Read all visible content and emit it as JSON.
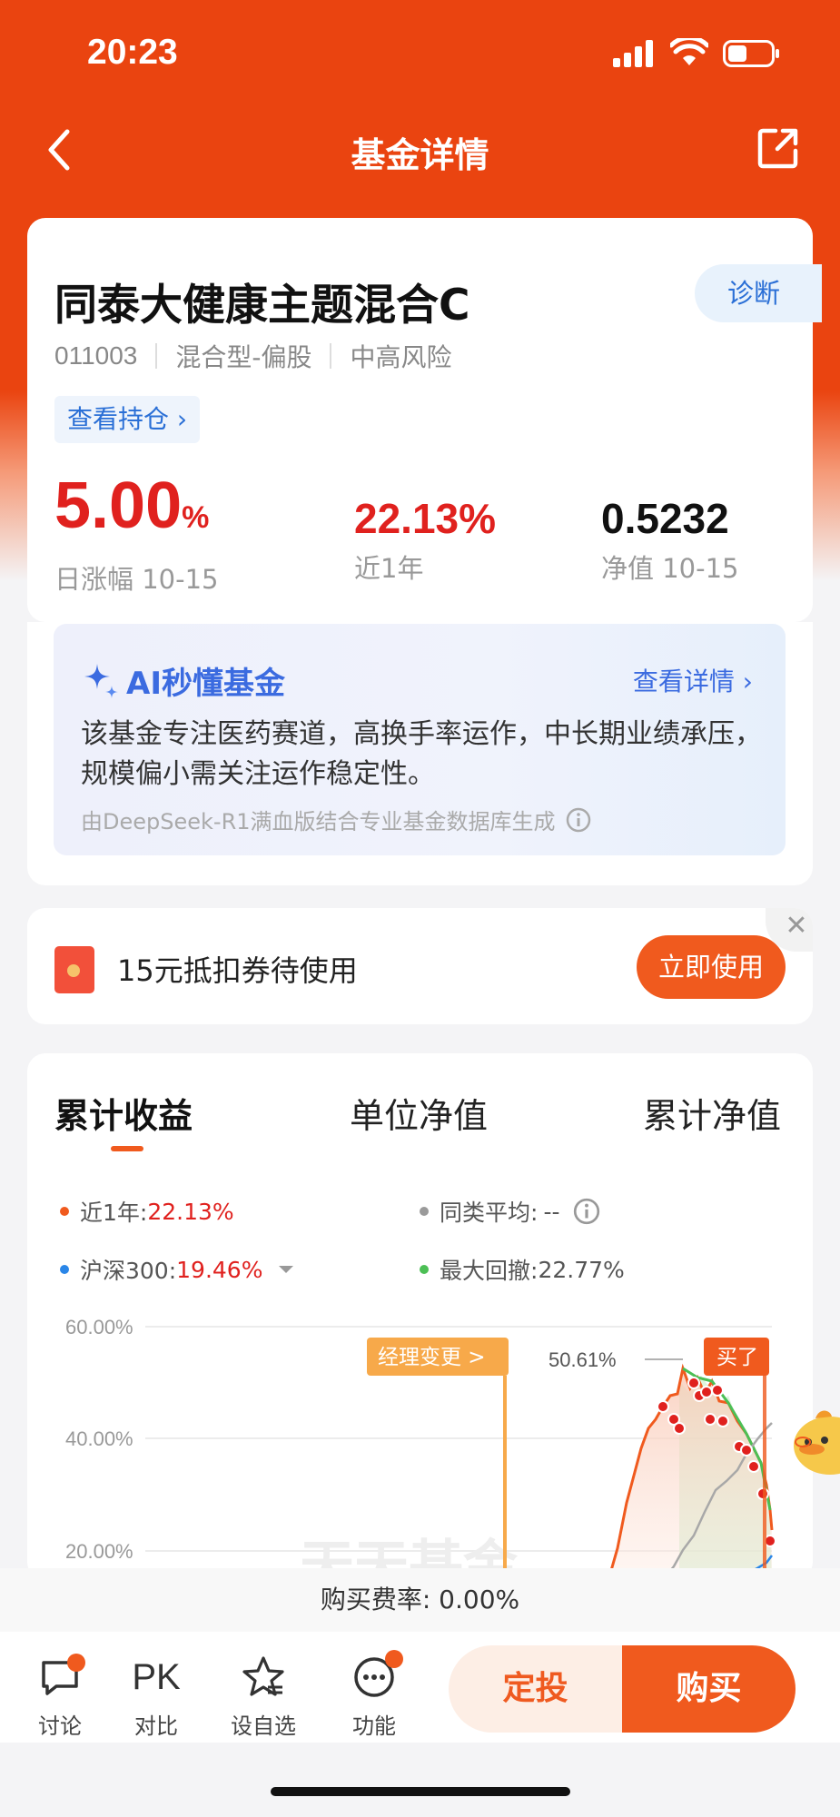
{
  "status_bar": {
    "time": "20:23"
  },
  "nav": {
    "title": "基金详情"
  },
  "fund": {
    "name": "同泰大健康主题混合C",
    "diagnose": "诊断",
    "code": "011003",
    "type": "混合型-偏股",
    "risk": "中高风险",
    "holdings": "查看持仓",
    "daily_change_value": "5.00",
    "daily_change_unit": "%",
    "daily_change_label": "日涨幅 10-15",
    "year_return": "22.13%",
    "year_return_label": "近1年",
    "nav_value": "0.5232",
    "nav_label": "净值 10-15"
  },
  "ai": {
    "title": "AI秒懂基金",
    "link": "查看详情",
    "text": "该基金专注医药赛道，高换手率运作，中长期业绩承压，规模偏小需关注运作稳定性。",
    "footer": "由DeepSeek-R1满血版结合专业基金数据库生成"
  },
  "coupon": {
    "text": "15元抵扣券待使用",
    "button": "立即使用"
  },
  "chart_tabs": [
    "累计收益",
    "单位净值",
    "累计净值"
  ],
  "legend": {
    "year_label": "近1年:",
    "year_value": "22.13%",
    "peer_label": "同类平均:",
    "peer_value": "--",
    "index_label": "沪深300:",
    "index_value": "19.46%",
    "drawdown_label": "最大回撤:",
    "drawdown_value": "22.77%"
  },
  "chart_data": {
    "type": "line",
    "yticks": [
      "60.00%",
      "40.00%",
      "20.00%"
    ],
    "ylim": [
      20,
      60
    ],
    "series": [
      {
        "name": "近1年",
        "color": "#f05a1e"
      },
      {
        "name": "同类平均",
        "color": "#9a9a9a"
      },
      {
        "name": "沪深300",
        "color": "#2a86e8"
      }
    ],
    "annotations": {
      "manager_change": "经理变更 >",
      "bought": "买了",
      "peak": "50.61%"
    },
    "watermark": "天天基金"
  },
  "fee": {
    "text": "购买费率: 0.00%"
  },
  "bottom": {
    "discuss": "讨论",
    "pk_icon": "PK",
    "compare": "对比",
    "watch": "设自选",
    "functions": "功能",
    "plan": "定投",
    "buy": "购买"
  }
}
